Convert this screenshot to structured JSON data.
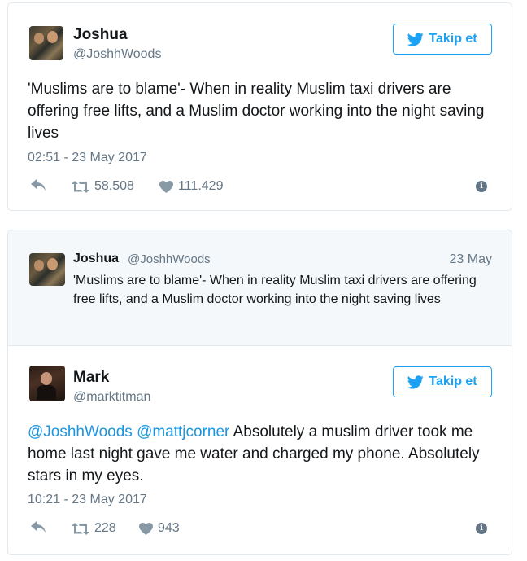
{
  "tweet1": {
    "name": "Joshua",
    "handle": "@JoshhWoods",
    "follow_label": "Takip et",
    "text": "'Muslims are to blame'- When in reality Muslim taxi drivers are offering free lifts, and a Muslim doctor working into the night saving lives",
    "timestamp": "02:51 - 23 May 2017",
    "retweets": "58.508",
    "likes": "111.429"
  },
  "tweet2": {
    "quoted": {
      "name": "Joshua",
      "handle": "@JoshhWoods",
      "date": "23 May",
      "text": "'Muslims are to blame'- When in reality Muslim taxi drivers are offering free lifts, and a Muslim doctor working into the night saving lives"
    },
    "name": "Mark",
    "handle": "@marktitman",
    "follow_label": "Takip et",
    "mention1": "@JoshhWoods",
    "mention2": "@mattjcorner",
    "text": "Absolutely a muslim driver took me home last night gave me water and charged my phone. Absolutely stars in my eyes.",
    "timestamp": "10:21 - 23 May 2017",
    "retweets": "228",
    "likes": "943"
  },
  "icons": {
    "follow": "twitter-bird-icon",
    "reply": "reply-icon",
    "retweet": "retweet-icon",
    "like": "heart-icon",
    "info": "info-icon"
  },
  "colors": {
    "accent": "#1da1f2",
    "mention": "#1b95e0",
    "muted": "#657786"
  }
}
